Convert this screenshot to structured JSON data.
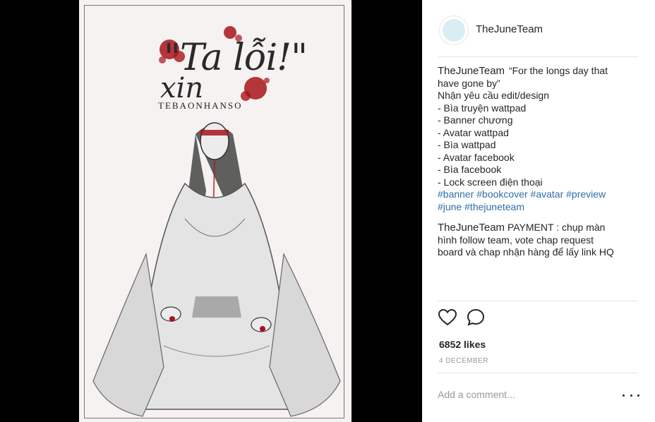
{
  "post": {
    "cover": {
      "title_line1": "\"Ta lỗi!\"",
      "title_line2": "xin",
      "author": "TEBAONHANSO"
    },
    "account": {
      "username": "TheJuneTeam",
      "avatar_icon": "profile-avatar"
    },
    "caption": {
      "author": "TheJuneTeam",
      "lines": [
        "“For the longs day that",
        "have gone by”",
        "Nhận yêu cầu edit/design",
        "- Bìa truyện wattpad",
        "- Banner chương",
        "- Avatar wattpad",
        "- Bìa wattpad",
        "- Avatar facebook",
        "- Bìa facebook",
        "- Lock screen điện thoại"
      ],
      "hashtags_line1": "#banner #bookcover #avatar #preview",
      "hashtags_line2": "#june #thejuneteam"
    },
    "comment": {
      "author": "TheJuneTeam",
      "lines": [
        "PAYMENT : chụp màn",
        "hình follow team, vote chap request",
        "board và chap nhận hàng để lấy link HQ"
      ]
    },
    "actions": {
      "like_icon": "heart-icon",
      "comment_icon": "speech-bubble-icon"
    },
    "likes": "6852 likes",
    "date": "4 DECEMBER",
    "add_comment_placeholder": "Add a comment...",
    "more_icon": "more-dots-icon",
    "colors": {
      "hashtag": "#2f6fa7",
      "text": "#262626",
      "muted": "#999999",
      "blood": "#a8141a"
    }
  }
}
